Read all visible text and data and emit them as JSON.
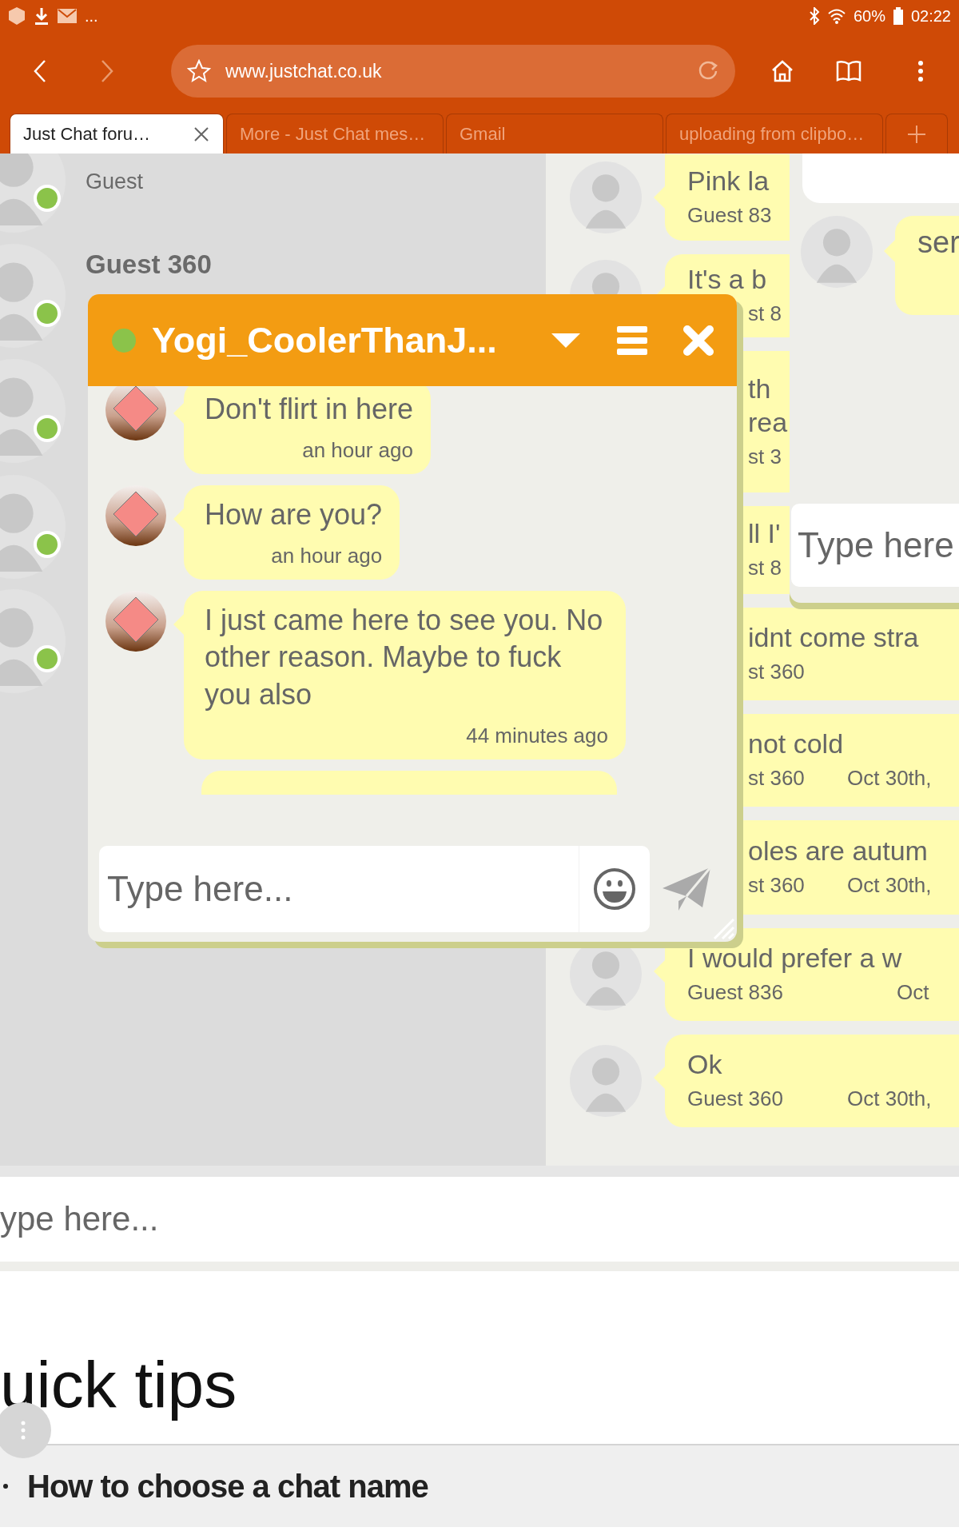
{
  "status_bar": {
    "more": "...",
    "battery": "60%",
    "time": "02:22"
  },
  "toolbar": {
    "url": "www.justchat.co.uk"
  },
  "tabs": [
    {
      "label": "Just Chat foru…",
      "selected": true
    },
    {
      "label": "More - Just Chat mes…",
      "selected": false
    },
    {
      "label": "Gmail",
      "selected": false
    },
    {
      "label": "uploading from clipbo…",
      "selected": false
    }
  ],
  "users": [
    {
      "subtitle": "Guest",
      "online": true
    },
    {
      "name": "Guest 360",
      "online": true
    },
    {
      "online": true
    },
    {
      "online": true
    },
    {
      "online": true
    }
  ],
  "room_messages": [
    {
      "lines": [
        "Pink la"
      ],
      "author": "Guest 83"
    },
    {
      "lines": [
        "It's a b"
      ],
      "author": "st 8"
    },
    {
      "lines": [
        "th",
        "rea"
      ],
      "author": "st 3"
    },
    {
      "lines": [
        "ll I'"
      ],
      "author": "st 8"
    },
    {
      "lines": [
        "idnt come stra"
      ],
      "author": "st 360"
    },
    {
      "lines": [
        "not cold"
      ],
      "author": "st 360",
      "date": "Oct 30th,"
    },
    {
      "lines": [
        "oles are autum"
      ],
      "author": "st 360",
      "date": "Oct 30th,"
    },
    {
      "lines": [
        "I would prefer a w"
      ],
      "author": "Guest 836",
      "date": "Oct"
    },
    {
      "lines": [
        "Ok"
      ],
      "author": "Guest 360",
      "date": "Oct 30th,"
    }
  ],
  "side_chat": {
    "messages": [
      {
        "text": "ser"
      }
    ],
    "placeholder": "Type here"
  },
  "popup": {
    "title": "Yogi_CoolerThanJ...",
    "online": true,
    "placeholder": "Type here...",
    "messages": [
      {
        "text": "Don't flirt in here",
        "time": "an hour ago"
      },
      {
        "text": "How are you?",
        "time": "an hour ago"
      },
      {
        "text": "I just came here to see you. No other reason. Maybe to fuck you also",
        "time": "44 minutes ago"
      }
    ]
  },
  "main_input": {
    "placeholder": "ype here..."
  },
  "tips": {
    "heading": "uick tips",
    "items": [
      "How to choose a chat name"
    ]
  }
}
